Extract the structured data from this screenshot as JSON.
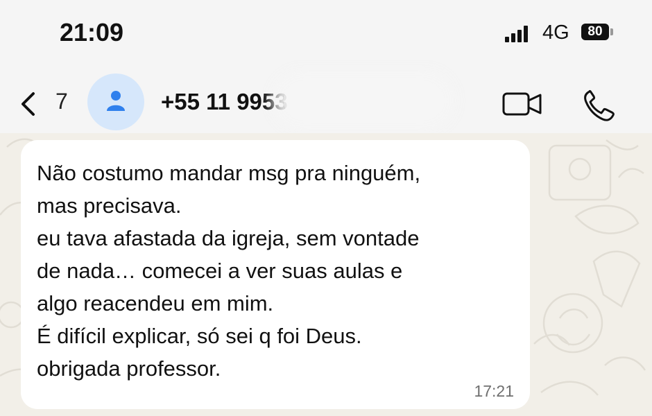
{
  "status_bar": {
    "time": "21:09",
    "network": "4G",
    "battery": "80",
    "signal_icon": "signal-bars-icon"
  },
  "header": {
    "back_count": "7",
    "contact_number": "+55 11 9953",
    "icons": [
      "back-chevron-icon",
      "avatar-person-icon",
      "video-call-icon",
      "phone-call-icon"
    ],
    "avatar_color": "#2f80ed"
  },
  "message": {
    "lines": [
      "Não costumo mandar msg pra ninguém,",
      "mas precisava.",
      "eu tava afastada da igreja, sem vontade",
      "de nada… comecei a ver suas aulas e",
      "algo reacendeu em mim.",
      "É difícil explicar, só sei q foi Deus.",
      "obrigada professor."
    ],
    "time": "17:21"
  },
  "colors": {
    "chat_background": "#f2efe8",
    "bubble": "#ffffff",
    "header": "#f5f5f5",
    "doodle": "#e1ddd4"
  }
}
